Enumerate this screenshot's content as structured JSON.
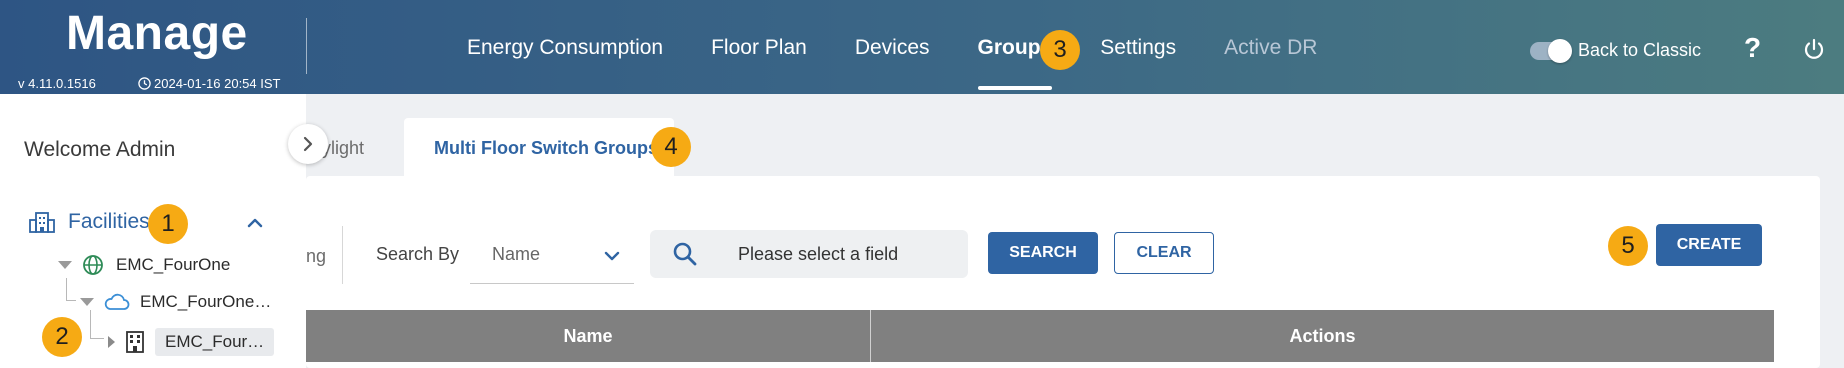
{
  "header": {
    "app_title": "Manage",
    "version": "v 4.11.0.1516",
    "timestamp": "2024-01-16 20:54 IST",
    "nav": [
      {
        "label": "Energy Consumption",
        "state": "normal"
      },
      {
        "label": "Floor Plan",
        "state": "normal"
      },
      {
        "label": "Devices",
        "state": "normal"
      },
      {
        "label": "Groups",
        "state": "active"
      },
      {
        "label": "Settings",
        "state": "normal"
      },
      {
        "label": "Active DR",
        "state": "disabled"
      }
    ],
    "toggle_label": "Back to Classic",
    "toggle_on": true,
    "help_label": "?",
    "icons": {
      "clock": "clock-icon",
      "power": "power-icon"
    }
  },
  "badges": [
    "1",
    "2",
    "3",
    "4",
    "5"
  ],
  "sidebar": {
    "welcome": "Welcome Admin",
    "facilities_label": "Facilities",
    "tree": [
      {
        "label": "EMC_FourOne",
        "icon": "globe-icon",
        "level": 1,
        "expanded": true
      },
      {
        "label": "EMC_FourOne…",
        "icon": "cloud-icon",
        "level": 2,
        "expanded": true
      },
      {
        "label": "EMC_Four…",
        "icon": "building-icon",
        "level": 3,
        "expanded": false,
        "selected": true
      }
    ]
  },
  "tabs": {
    "previous_partial": "ylight",
    "active": "Multi Floor Switch Groups"
  },
  "filters": {
    "truncated_text": "ng",
    "search_by_label": "Search By",
    "search_by_value": "Name",
    "search_placeholder": "Please select a field",
    "search_button": "SEARCH",
    "clear_button": "CLEAR",
    "create_button": "CREATE"
  },
  "table": {
    "columns": [
      "Name",
      "Actions"
    ]
  },
  "colors": {
    "primary": "#2f64a3",
    "badge": "#f6aa14",
    "header_start": "#2e5584",
    "header_end": "#4c7c80",
    "table_header": "#808080"
  }
}
